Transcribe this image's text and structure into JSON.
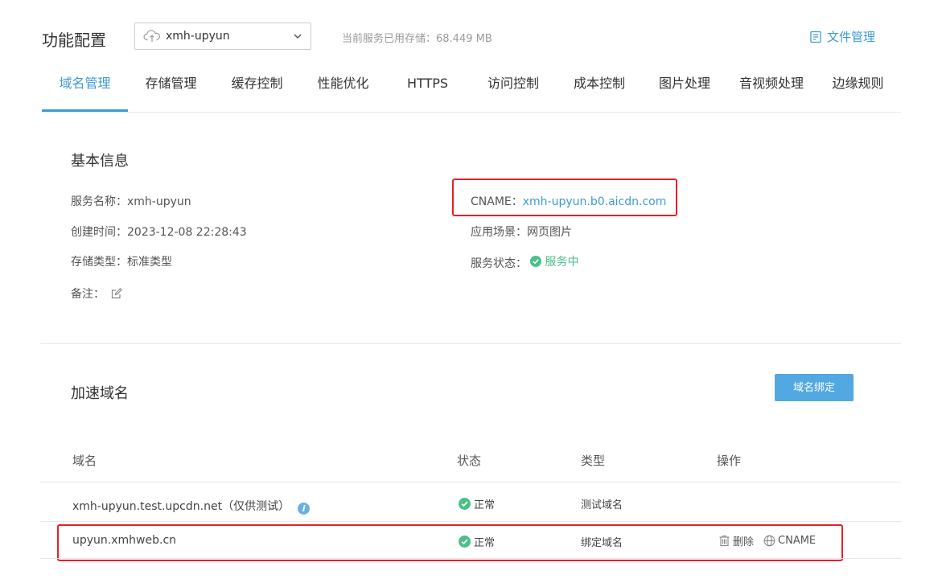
{
  "header": {
    "title": "功能配置",
    "service_select": "xmh-upyun",
    "storage_used": "当前服务已用存储：68.449 MB",
    "file_mgmt": "文件管理"
  },
  "tabs": [
    {
      "label": "域名管理",
      "active": true
    },
    {
      "label": "存储管理"
    },
    {
      "label": "缓存控制"
    },
    {
      "label": "性能优化"
    },
    {
      "label": "HTTPS"
    },
    {
      "label": "访问控制"
    },
    {
      "label": "成本控制"
    },
    {
      "label": "图片处理"
    },
    {
      "label": "音视频处理"
    },
    {
      "label": "边缘规则"
    }
  ],
  "basic": {
    "title": "基本信息",
    "service_name_label": "服务名称：",
    "service_name": "xmh-upyun",
    "created_label": "创建时间：",
    "created": "2023-12-08 22:28:43",
    "storage_type_label": "存储类型：",
    "storage_type": "标准类型",
    "note_label": "备注：",
    "cname_label": "CNAME：",
    "cname": "xmh-upyun.b0.aicdn.com",
    "scene_label": "应用场景：",
    "scene": "网页图片",
    "status_label": "服务状态：",
    "status": "服务中"
  },
  "domains": {
    "title": "加速域名",
    "bind_button": "域名绑定",
    "columns": [
      "域名",
      "状态",
      "类型",
      "操作"
    ],
    "rows": [
      {
        "domain": "xmh-upyun.test.upcdn.net（仅供测试）",
        "status": "正常",
        "type": "测试域名"
      },
      {
        "domain": "upyun.xmhweb.cn",
        "status": "正常",
        "type": "绑定域名",
        "op_delete": "删除",
        "op_cname": "CNAME"
      }
    ]
  },
  "colors": {
    "accent": "#3c9bd3",
    "success": "#4cbf8a",
    "highlight": "#e8202a"
  }
}
